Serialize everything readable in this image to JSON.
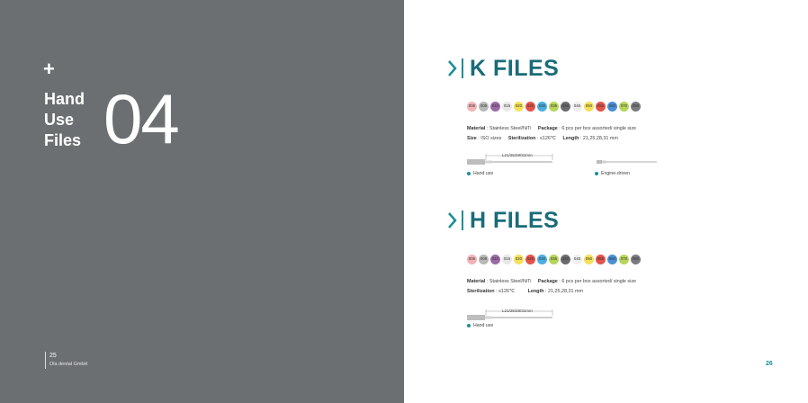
{
  "left_page": {
    "plus": "+",
    "chapter_lines": [
      "Hand",
      "Use",
      "Files"
    ],
    "chapter_number": "04",
    "page_number": "25",
    "company": "Ola dental GmbH"
  },
  "k_files": {
    "title": "K FILES",
    "sizes": [
      {
        "label": "006",
        "color": "#f2b3b6"
      },
      {
        "label": "008",
        "color": "#b9b8b8"
      },
      {
        "label": "010",
        "color": "#9b6aa6"
      },
      {
        "label": "015",
        "color": "#e8e8e8"
      },
      {
        "label": "020",
        "color": "#f4e05a"
      },
      {
        "label": "025",
        "color": "#e2534a"
      },
      {
        "label": "030",
        "color": "#4aaee0"
      },
      {
        "label": "035",
        "color": "#b7d45b"
      },
      {
        "label": "040",
        "color": "#6a6b6d"
      },
      {
        "label": "045",
        "color": "#eeeeee"
      },
      {
        "label": "050",
        "color": "#f4e05a"
      },
      {
        "label": "055",
        "color": "#e2534a"
      },
      {
        "label": "060",
        "color": "#4a8ed6"
      },
      {
        "label": "070",
        "color": "#b7d45b"
      },
      {
        "label": "080",
        "color": "#7a7b7d"
      }
    ],
    "spec_row1": [
      {
        "key": "Material",
        "value": "Stainless Steel/NiTi"
      },
      {
        "key": "Package",
        "value": "6 pcs per box   assorted/ single size"
      }
    ],
    "spec_row2": [
      {
        "key": "Size",
        "value": "ISO sizes"
      },
      {
        "key": "Sterilization",
        "value": "≤126℃"
      },
      {
        "key": "Length",
        "value": "21,25,28,31 mm"
      }
    ],
    "dimension_label": "L21/25/28/31mm",
    "hand_label": "Hand use",
    "engine_label": "Engine-driven"
  },
  "h_files": {
    "title": "H FILES",
    "sizes": [
      {
        "label": "006",
        "color": "#f2b3b6"
      },
      {
        "label": "008",
        "color": "#b9b8b8"
      },
      {
        "label": "010",
        "color": "#9b6aa6"
      },
      {
        "label": "015",
        "color": "#e8e8e8"
      },
      {
        "label": "020",
        "color": "#f4e05a"
      },
      {
        "label": "025",
        "color": "#e2534a"
      },
      {
        "label": "030",
        "color": "#4aaee0"
      },
      {
        "label": "035",
        "color": "#b7d45b"
      },
      {
        "label": "040",
        "color": "#6a6b6d"
      },
      {
        "label": "045",
        "color": "#eeeeee"
      },
      {
        "label": "050",
        "color": "#f4e05a"
      },
      {
        "label": "055",
        "color": "#e2534a"
      },
      {
        "label": "060",
        "color": "#4a8ed6"
      },
      {
        "label": "070",
        "color": "#b7d45b"
      },
      {
        "label": "080",
        "color": "#7a7b7d"
      }
    ],
    "spec_row1": [
      {
        "key": "Material",
        "value": "Stainless Steel/NiTi"
      },
      {
        "key": "Package",
        "value": "6 pcs per box   assorted/ single size"
      }
    ],
    "spec_row2": [
      {
        "key": "Sterilization",
        "value": "≤126℃"
      },
      {
        "key": "Length",
        "value": "21,25,28,31 mm"
      }
    ],
    "dimension_label": "L21/25/28/31mm",
    "hand_label": "Hand use"
  },
  "right_page": {
    "page_number": "26"
  },
  "colors": {
    "left_bg": "#6c6f71",
    "accent": "#1a8f94",
    "title": "#1a6c78"
  }
}
